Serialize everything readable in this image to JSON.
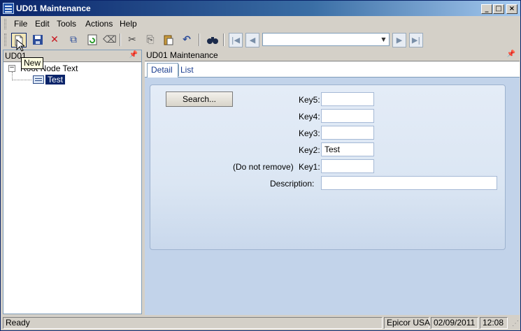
{
  "window": {
    "title": "UD01 Maintenance",
    "minimize_icon": "minimize-icon",
    "maximize_icon": "maximize-icon",
    "close_icon": "close-icon"
  },
  "menu": [
    "File",
    "Edit",
    "Tools",
    "Actions",
    "Help"
  ],
  "toolbar": {
    "icons": [
      "new-icon",
      "save-icon",
      "delete-icon",
      "attach-icon",
      "refresh-icon",
      "clear-icon",
      "cut-icon",
      "copy-icon",
      "paste-icon",
      "undo-icon",
      "find-icon",
      "first-record-icon",
      "previous-record-icon",
      "next-record-icon",
      "last-record-icon"
    ],
    "nav_combo_value": "",
    "tooltip": "New"
  },
  "tree": {
    "header": "UD01",
    "root_label": "Root Node Text",
    "child_label": "Test"
  },
  "detail": {
    "header": "UD01 Maintenance",
    "tabs": [
      "Detail",
      "List"
    ],
    "search_label": "Search...",
    "fields": {
      "key5": {
        "label": "Key5:",
        "value": ""
      },
      "key4": {
        "label": "Key4:",
        "value": ""
      },
      "key3": {
        "label": "Key3:",
        "value": ""
      },
      "key2": {
        "label": "Key2:",
        "value": "Test"
      },
      "key1": {
        "label": "Key1:",
        "value": "",
        "note": "(Do not remove)"
      },
      "description": {
        "label": "Description:",
        "value": ""
      }
    }
  },
  "status": {
    "text": "Ready",
    "company": "Epicor USA",
    "date": "02/09/2011",
    "time": "12:08"
  },
  "colors": {
    "title_bar": "#0a246a",
    "selection": "#0a246a",
    "form_background": "#dbe6f3",
    "pane_background": "#c2d3ea"
  }
}
